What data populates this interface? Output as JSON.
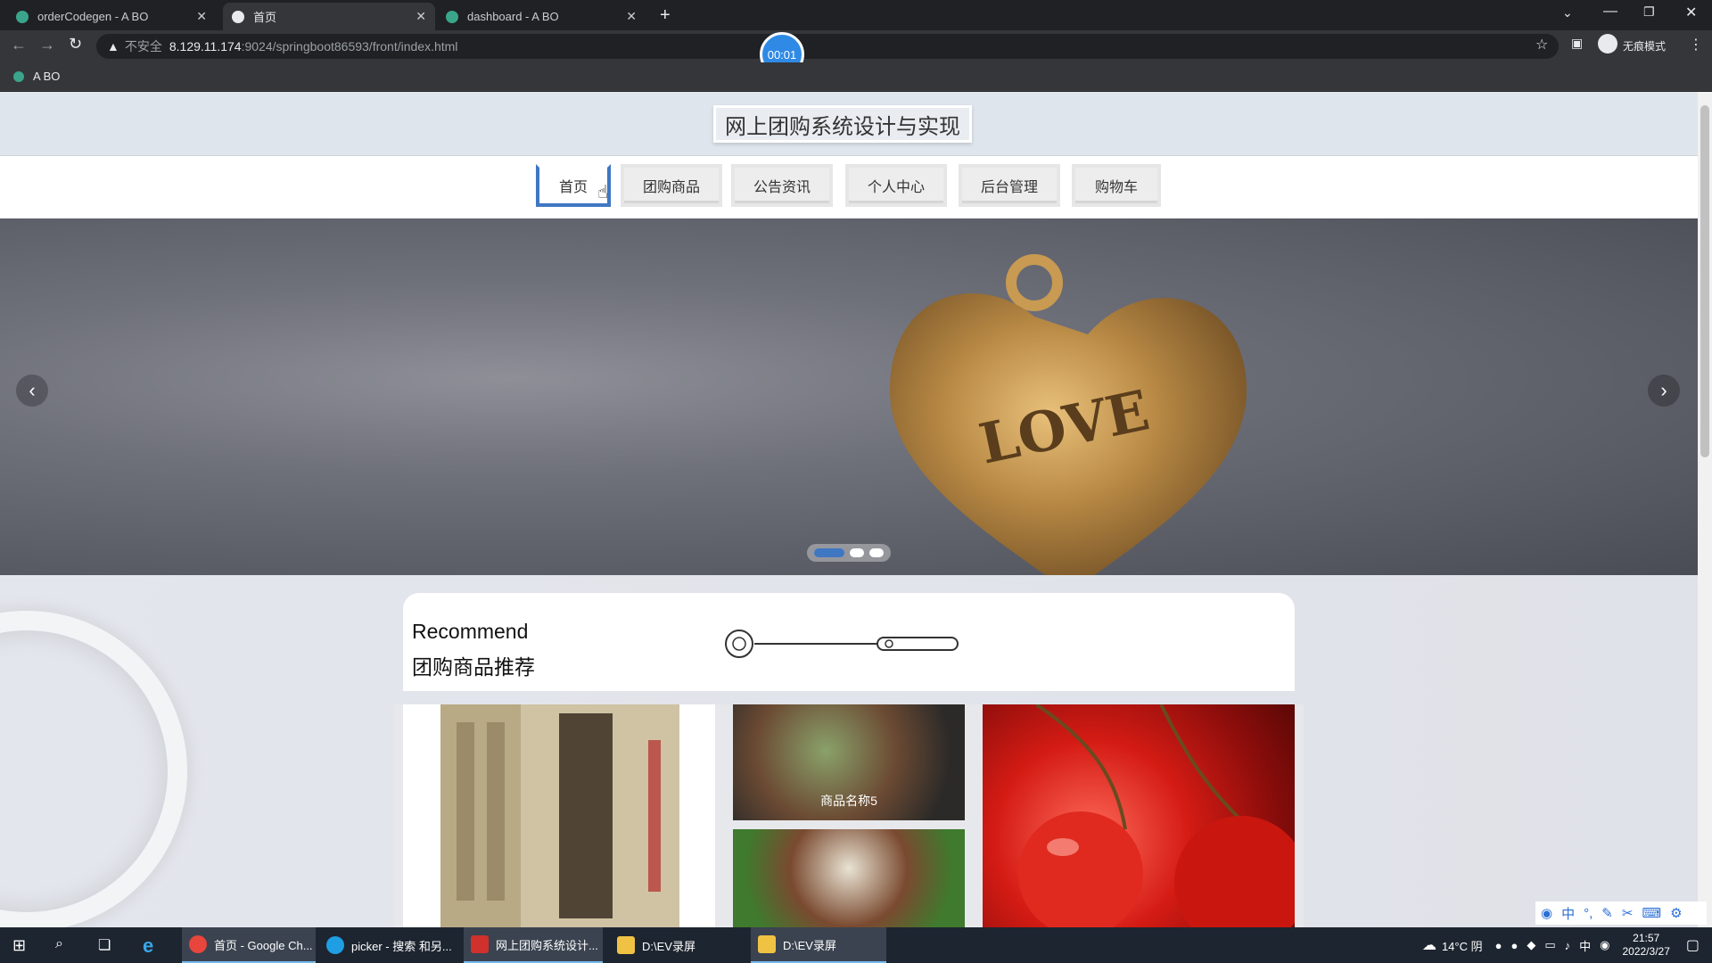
{
  "browser": {
    "tabs": [
      {
        "title": "orderCodegen - A BO",
        "active": false
      },
      {
        "title": "首页",
        "active": true
      },
      {
        "title": "dashboard - A BO",
        "active": false
      }
    ],
    "new_tab": "+",
    "address": {
      "warning": "不安全",
      "host": "8.129.11.174",
      "path": ":9024/springboot86593/front/index.html"
    },
    "incognito_label": "无痕模式",
    "bookmark": "A BO",
    "recording_timer": "00:01"
  },
  "site": {
    "title": "网上团购系统设计与实现",
    "nav": [
      {
        "label": "首页",
        "active": true
      },
      {
        "label": "团购商品",
        "active": false
      },
      {
        "label": "公告资讯",
        "active": false
      },
      {
        "label": "个人中心",
        "active": false
      },
      {
        "label": "后台管理",
        "active": false
      },
      {
        "label": "购物车",
        "active": false
      }
    ],
    "carousel": {
      "slide_text": "LOVE",
      "prev": "‹",
      "next": "›",
      "slide_count": 3,
      "active_slide": 1
    },
    "recommend": {
      "en": "Recommend",
      "cn": "团购商品推荐"
    },
    "goods": [
      {
        "caption": ""
      },
      {
        "caption": "商品名称5"
      },
      {
        "caption": ""
      },
      {
        "caption": ""
      }
    ]
  },
  "taskbar": {
    "items": [
      {
        "label": "首页 - Google Ch...",
        "icon": "chrome-icon",
        "color": "#e8453c"
      },
      {
        "label": "picker - 搜索 和另...",
        "icon": "edge-icon",
        "color": "#1f9ee3"
      },
      {
        "label": "网上团购系统设计...",
        "icon": "wps-icon",
        "color": "#d0312d"
      },
      {
        "label": "D:\\EV录屏",
        "icon": "folder-icon",
        "color": "#f0c243"
      },
      {
        "label": "D:\\EV录屏",
        "icon": "folder-icon",
        "color": "#f0c243"
      }
    ],
    "weather": "14°C 阴",
    "ime": "中",
    "time": "21:57",
    "date": "2022/3/27"
  }
}
